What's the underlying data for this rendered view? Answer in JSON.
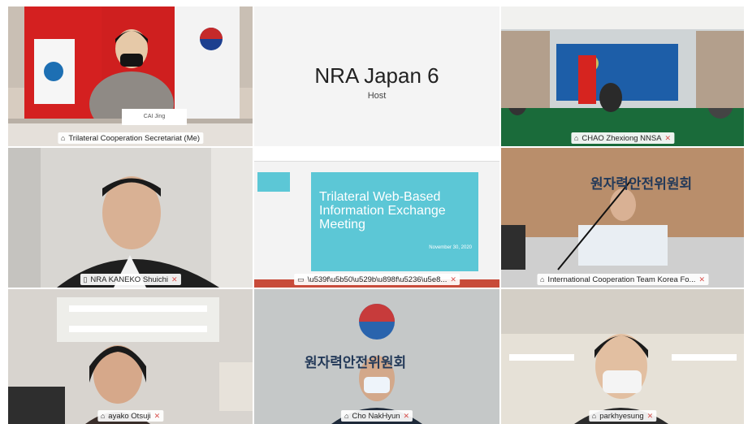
{
  "tiles": [
    {
      "name": "Trilateral Cooperation Secretariat (Me)",
      "icon": "pin-icon",
      "mic": "muted",
      "nameplate": "CAI Jing"
    },
    {
      "name": "NRA Japan 6",
      "subtitle": "Host"
    },
    {
      "name": "CHAO Zhexiong NNSA",
      "icon": "pin-icon",
      "mic": "muted"
    },
    {
      "name": "NRA KANEKO Shuichi",
      "icon": "phone-icon",
      "mic": "muted"
    },
    {
      "name": "\\u539f\\u5b50\\u529b\\u898f\\u5236\\u5e8...",
      "icon": "desktop-icon",
      "mic": "muted",
      "slide": {
        "title": "Trilateral Web-Based Information Exchange Meeting",
        "date": "November 30, 2020"
      }
    },
    {
      "name": "International Cooperation Team Korea Fo...",
      "icon": "pin-icon",
      "mic": "muted",
      "sign": "원자력안전위원회"
    },
    {
      "name": "ayako Otsuji",
      "icon": "pin-icon",
      "mic": "muted"
    },
    {
      "name": "Cho NakHyun",
      "icon": "pin-icon",
      "mic": "muted",
      "sign": "원자력안전위원회"
    },
    {
      "name": "parkhyesung",
      "icon": "pin-icon",
      "mic": "muted"
    }
  ],
  "colors": {
    "active_border": "#4aa3df",
    "muted_mic": "#d9534f",
    "slide_bg": "#5cc7d6"
  }
}
